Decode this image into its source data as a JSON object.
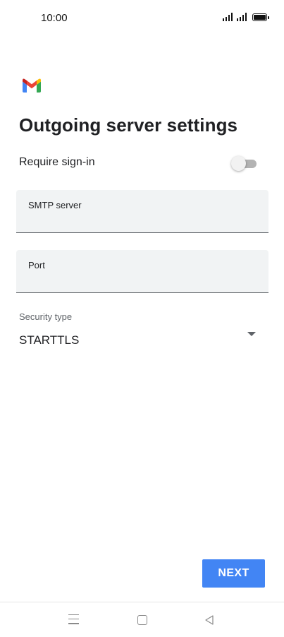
{
  "status_bar": {
    "time": "10:00"
  },
  "header": {
    "logo_icon": "gmail-logo",
    "title": "Outgoing server settings"
  },
  "require_signin": {
    "label": "Require sign-in",
    "enabled": false
  },
  "smtp_server": {
    "label": "SMTP server",
    "value": ""
  },
  "port": {
    "label": "Port",
    "value": ""
  },
  "security_type": {
    "label": "Security type",
    "value": "STARTTLS"
  },
  "actions": {
    "next_label": "NEXT"
  },
  "colors": {
    "accent": "#4285f4",
    "field_background": "#f1f3f4",
    "text": "#202124"
  },
  "nav_bar": {
    "icons": [
      "menu-icon",
      "home-icon",
      "back-icon"
    ]
  }
}
